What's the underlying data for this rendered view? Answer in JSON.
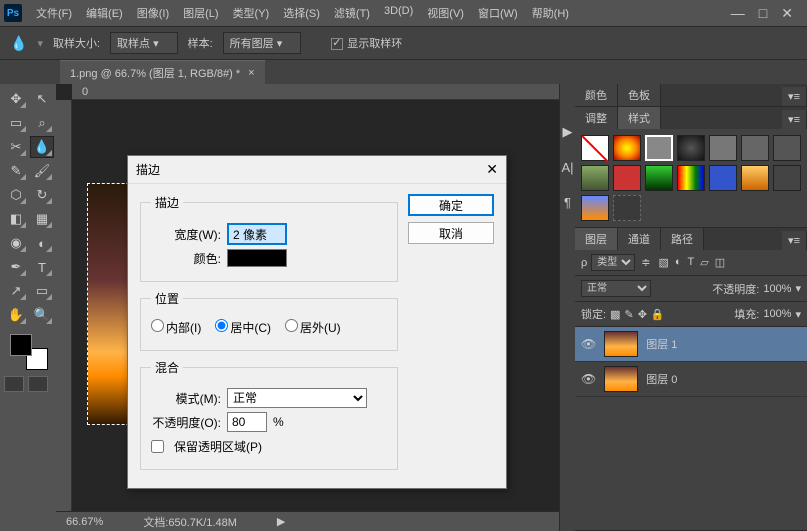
{
  "menu": {
    "file": "文件(F)",
    "edit": "编辑(E)",
    "image": "图像(I)",
    "layer": "图层(L)",
    "type": "类型(Y)",
    "select": "选择(S)",
    "filter": "滤镜(T)",
    "threed": "3D(D)",
    "view": "视图(V)",
    "window": "窗口(W)",
    "help": "帮助(H)"
  },
  "options": {
    "sample_size_label": "取样大小:",
    "sample_size_value": "取样点",
    "sample_label": "样本:",
    "sample_value": "所有图层",
    "show_ring": "显示取样环"
  },
  "doc": {
    "tab": "1.png @ 66.7% (图层 1, RGB/8#) *"
  },
  "panels": {
    "color": "颜色",
    "swatch": "色板",
    "adjust": "调整",
    "styles": "样式",
    "layers": "图层",
    "channels": "通道",
    "paths": "路径",
    "kind": "类型",
    "blend": "正常",
    "opacity_label": "不透明度:",
    "opacity": "100%",
    "lock_label": "锁定:",
    "fill_label": "填充:",
    "fill": "100%",
    "layer1": "图层 1",
    "layer0": "图层 0"
  },
  "status": {
    "zoom": "66.67%",
    "doc": "文档:650.7K/1.48M"
  },
  "dialog": {
    "title": "描边",
    "ok": "确定",
    "cancel": "取消",
    "stroke_group": "描边",
    "width_label": "宽度(W):",
    "width_value": "2 像素",
    "color_label": "颜色:",
    "position_group": "位置",
    "inside": "内部(I)",
    "center": "居中(C)",
    "outside": "居外(U)",
    "blend_group": "混合",
    "mode_label": "模式(M):",
    "mode_value": "正常",
    "opacity_label": "不透明度(O):",
    "opacity_value": "80",
    "opacity_pct": "%",
    "preserve": "保留透明区域(P)"
  }
}
